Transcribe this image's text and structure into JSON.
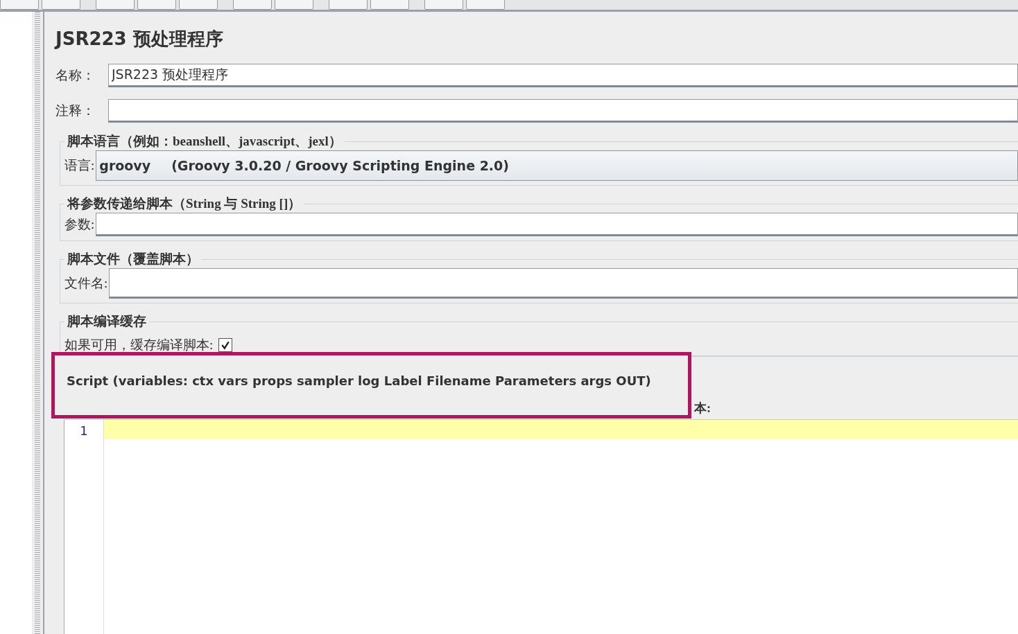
{
  "title": "JSR223 预处理程序",
  "fields": [
    {
      "label": "名称：",
      "value": "JSR223 预处理程序"
    },
    {
      "label": "注释："
    }
  ],
  "language_section": {
    "title": "脚本语言（例如：beanshell、javascript、jexl）",
    "label": "语言:",
    "value": "groovy",
    "engine": "(Groovy 3.0.20 / Groovy Scripting Engine 2.0)"
  },
  "parameters_section": {
    "title": "将参数传递给脚本（String 与 String []）",
    "label": "参数:"
  },
  "file_section": {
    "title": "脚本文件（覆盖脚本）",
    "label": "文件名:"
  },
  "cache_section": {
    "title": "脚本编译缓存",
    "label": "如果可用，缓存编译脚本:",
    "checked": true
  },
  "script_section": {
    "label": "本:",
    "line_numbers": [
      "1"
    ]
  },
  "annotation": {
    "text": "Script (variables: ctx vars props sampler log Label Filename Parameters args OUT)"
  }
}
